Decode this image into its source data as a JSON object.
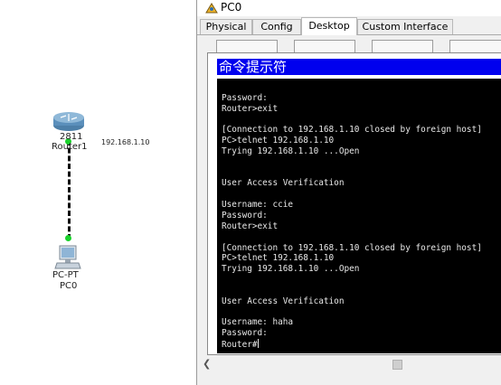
{
  "topology": {
    "router": {
      "model": "2811",
      "name": "Router1"
    },
    "link_ip": "192.168.1.10",
    "pc": {
      "type": "PC-PT",
      "name": "PC0"
    },
    "colors": {
      "link_dot": "#19d12b"
    }
  },
  "window": {
    "title": "PC0",
    "tabs": [
      "Physical",
      "Config",
      "Desktop",
      "Custom Interface"
    ],
    "active_tab": "Desktop"
  },
  "terminal": {
    "title": "命令提示符",
    "lines": [
      "User Access Verification",
      "",
      "Password:",
      "Router>exit",
      "",
      "[Connection to 192.168.1.10 closed by foreign host]",
      "PC>telnet 192.168.1.10",
      "Trying 192.168.1.10 ...Open",
      "",
      "",
      "User Access Verification",
      "",
      "Username: ccie",
      "Password:",
      "Router>exit",
      "",
      "[Connection to 192.168.1.10 closed by foreign host]",
      "PC>telnet 192.168.1.10",
      "Trying 192.168.1.10 ...Open",
      "",
      "",
      "User Access Verification",
      "",
      "Username: haha",
      "Password:"
    ],
    "prompt": "Router#"
  },
  "icons": {
    "router": "router-icon",
    "pc": "pc-icon",
    "window": "packet-tracer-icon",
    "scroll_left": "chevron-left-icon"
  }
}
